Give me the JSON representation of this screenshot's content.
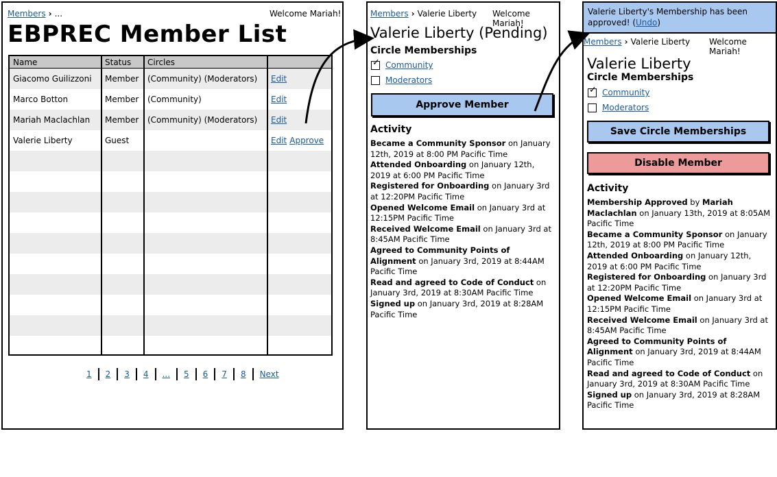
{
  "panel1": {
    "breadcrumb": {
      "link": "Members",
      "rest": "..."
    },
    "welcome": "Welcome Mariah!",
    "title": "EBPREC Member List",
    "columns": [
      "Name",
      "Status",
      "Circles",
      ""
    ],
    "rows": [
      {
        "name": "Giacomo Guilizzoni",
        "status": "Member",
        "circles": "(Community) (Moderators)",
        "edit": "Edit",
        "approve": ""
      },
      {
        "name": "Marco Botton",
        "status": "Member",
        "circles": "(Community)",
        "edit": "Edit",
        "approve": ""
      },
      {
        "name": "Mariah Maclachlan",
        "status": "Member",
        "circles": "(Community) (Moderators)",
        "edit": "Edit",
        "approve": ""
      },
      {
        "name": "Valerie Liberty",
        "status": "Guest",
        "circles": "",
        "edit": "Edit",
        "approve": "Approve"
      }
    ],
    "pager": [
      "1",
      "2",
      "3",
      "4",
      "...",
      "5",
      "6",
      "7",
      "8",
      "Next"
    ]
  },
  "panel2": {
    "breadcrumb": {
      "link": "Members",
      "current": "Valerie Liberty"
    },
    "welcome": "Welcome Mariah!",
    "title": "Valerie Liberty (Pending)",
    "circles_heading": "Circle Memberships",
    "circles": [
      {
        "label": "Community",
        "checked": true
      },
      {
        "label": "Moderators",
        "checked": false
      }
    ],
    "approve_button": "Approve Member",
    "activity_heading": "Activity",
    "activity": [
      {
        "bold": "Became a Community Sponsor",
        "text": " on January 12th, 2019 at 8:00 PM Pacific Time"
      },
      {
        "bold": "Attended Onboarding",
        "text": " on January 12th, 2019 at 6:00 PM Pacific Time"
      },
      {
        "bold": "Registered for Onboarding",
        "text": " on January 3rd at 12:20PM Pacific Time"
      },
      {
        "bold": "Opened Welcome Email",
        "text": " on January 3rd at 12:15PM Pacific Time"
      },
      {
        "bold": "Received Welcome Email",
        "text": " on January 3rd at 8:45AM Pacific Time"
      },
      {
        "bold": "Agreed to Community Points of Alignment",
        "text": " on January 3rd, 2019 at 8:44AM Pacific Time"
      },
      {
        "bold": "Read and agreed to Code of Conduct",
        "text": " on January 3rd, 2019 at 8:30AM Pacific Time"
      },
      {
        "bold": "Signed up",
        "text": " on January 3rd, 2019 at 8:28AM Pacific Time"
      }
    ]
  },
  "panel3": {
    "banner_text": "Valerie Liberty's Membership has been approved! (",
    "banner_undo": "Undo",
    "banner_close": ")",
    "breadcrumb": {
      "link": "Members",
      "current": "Valerie Liberty"
    },
    "welcome": "Welcome Mariah!",
    "title": "Valerie Liberty",
    "circles_heading": "Circle Memberships",
    "circles": [
      {
        "label": "Community",
        "checked": true
      },
      {
        "label": "Moderators",
        "checked": false
      }
    ],
    "save_button": "Save Circle Memberships",
    "disable_button": "Disable Member",
    "activity_heading": "Activity",
    "activity": [
      {
        "bold": "Membership Approved",
        "text": " by ",
        "bold2": "Mariah Maclachlan",
        "text2": " on January 13th, 2019 at 8:05AM Pacific Time"
      },
      {
        "bold": "Became a Community Sponsor",
        "text": " on January 12th, 2019 at 8:00 PM Pacific Time"
      },
      {
        "bold": "Attended Onboarding",
        "text": " on January 12th, 2019 at 6:00 PM Pacific Time"
      },
      {
        "bold": "Registered for Onboarding",
        "text": " on January 3rd at 12:20PM Pacific Time"
      },
      {
        "bold": "Opened Welcome Email",
        "text": " on January 3rd at 12:15PM Pacific Time"
      },
      {
        "bold": "Received Welcome Email",
        "text": " on January 3rd at 8:45AM Pacific Time"
      },
      {
        "bold": "Agreed to Community Points of Alignment",
        "text": " on January 3rd, 2019 at 8:44AM Pacific Time"
      },
      {
        "bold": "Read and agreed to Code of Conduct",
        "text": " on January 3rd, 2019 at 8:30AM Pacific Time"
      },
      {
        "bold": "Signed up",
        "text": " on January 3rd, 2019 at 8:28AM Pacific Time"
      }
    ]
  },
  "colors": {
    "link": "#1a5a9c",
    "button_blue": "#a9c8f0",
    "button_red": "#ec9a9a",
    "header_gray": "#c8c8c8",
    "row_alt": "#ececec"
  }
}
